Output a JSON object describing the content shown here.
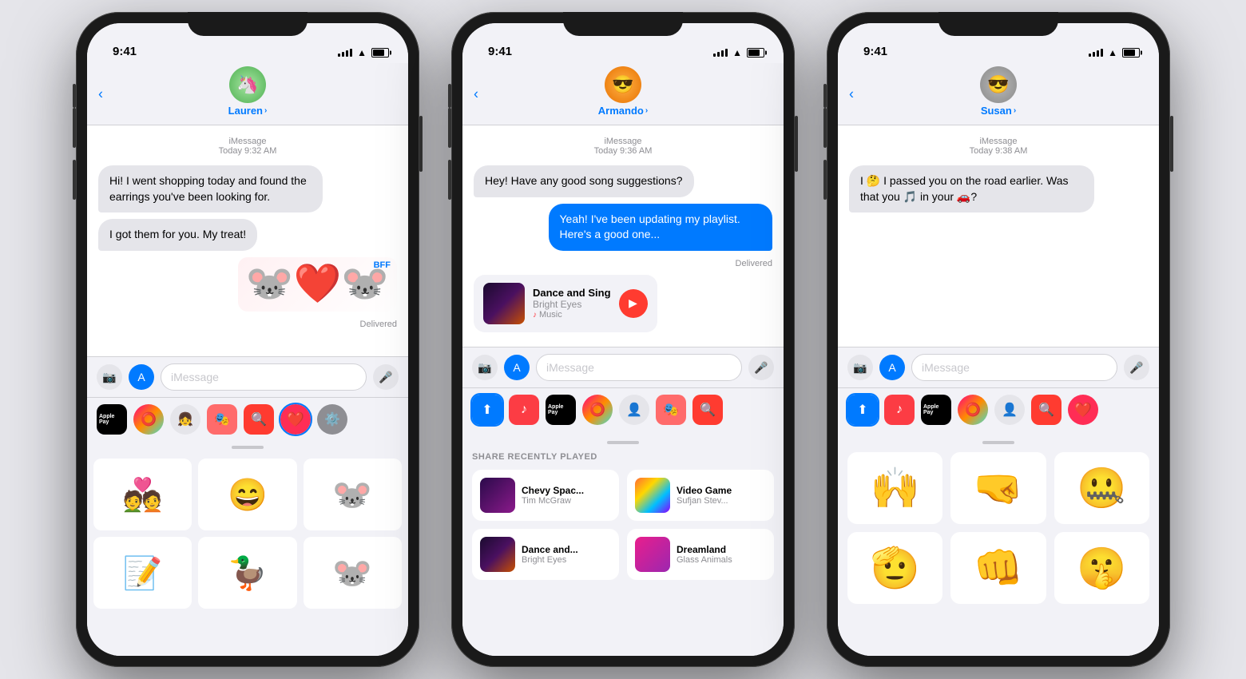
{
  "phones": [
    {
      "id": "phone1",
      "status_time": "9:41",
      "contact_name": "Lauren",
      "contact_avatar_emoji": "🦄",
      "contact_avatar_class": "avatar-green",
      "imessage_label": "iMessage",
      "date_label": "Today 9:32 AM",
      "messages": [
        {
          "type": "received",
          "text": "Hi! I went shopping today and found the earrings you've been looking for."
        },
        {
          "type": "received",
          "text": "I got them for you. My treat!"
        },
        {
          "type": "sticker",
          "text": "BFF 🎀"
        },
        {
          "type": "delivered"
        }
      ],
      "input_placeholder": "iMessage",
      "tray_items": [
        "Apple Pay",
        "🎨",
        "👧",
        "🎭",
        "🔍",
        "❤️",
        "⚙️"
      ],
      "panel_type": "stickers",
      "stickers": [
        "💑",
        "😄",
        "🐭",
        "📝",
        "🦆",
        "🐭"
      ]
    },
    {
      "id": "phone2",
      "status_time": "9:41",
      "contact_name": "Armando",
      "contact_avatar_emoji": "😎",
      "contact_avatar_class": "avatar-pink",
      "imessage_label": "iMessage",
      "date_label": "Today 9:36 AM",
      "messages": [
        {
          "type": "received",
          "text": "Hey! Have any good song suggestions?"
        },
        {
          "type": "sent",
          "text": "Yeah! I've been updating my playlist. Here's a good one..."
        },
        {
          "type": "delivered"
        },
        {
          "type": "music_card",
          "title": "Dance and Sing",
          "artist": "Bright Eyes",
          "source": "Apple Music"
        }
      ],
      "input_placeholder": "iMessage",
      "tray_items": [
        "⬆️",
        "🎵",
        "Apple Pay",
        "🎨",
        "👤",
        "🎭",
        "🔍"
      ],
      "panel_type": "recently_played",
      "panel_title": "SHARE RECENTLY PLAYED",
      "recently_played": [
        {
          "title": "Chevy Spac...",
          "artist": "Tim McGraw",
          "thumb_class": "thumb-chevy"
        },
        {
          "title": "Video Game",
          "artist": "Sufjan Stev...",
          "thumb_class": "thumb-video"
        },
        {
          "title": "Dance and...",
          "artist": "Bright Eyes",
          "thumb_class": "thumb-dance"
        },
        {
          "title": "Dreamland",
          "artist": "Glass Animals",
          "thumb_class": "thumb-dreamland"
        }
      ]
    },
    {
      "id": "phone3",
      "status_time": "9:41",
      "contact_name": "Susan",
      "contact_avatar_emoji": "😎",
      "contact_avatar_class": "avatar-gray",
      "imessage_label": "iMessage",
      "date_label": "Today 9:38 AM",
      "messages": [
        {
          "type": "received",
          "text": "I 🤔 I passed you on the road earlier. Was that you 🎵 in your 🚗?"
        }
      ],
      "input_placeholder": "iMessage",
      "tray_items": [
        "⬆️",
        "🎵",
        "Apple Pay",
        "🎨",
        "👤",
        "🔍",
        "❤️"
      ],
      "panel_type": "memoji",
      "memojis": [
        "🙌",
        "🤜",
        "🤐",
        "🫡",
        "👊",
        "🤫"
      ]
    }
  ],
  "music_card": {
    "title": "Dance and Sing",
    "artist": "Bright Eyes",
    "source": "♪ Music",
    "delivered": "Delivered"
  }
}
